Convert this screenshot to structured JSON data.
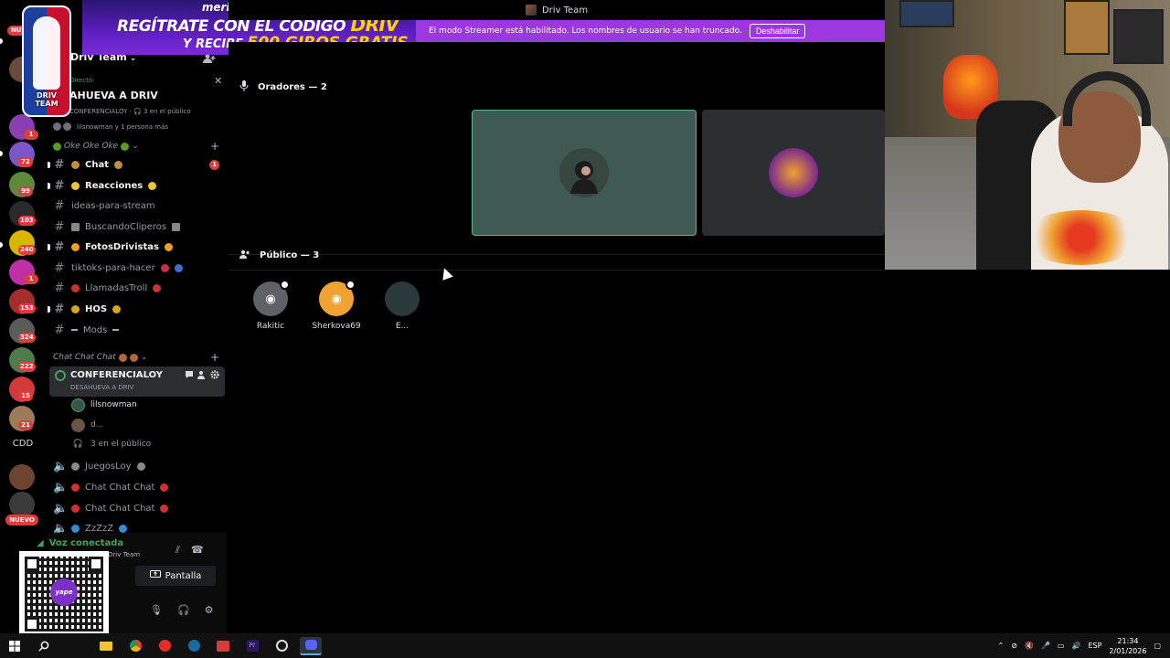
{
  "window": {
    "title": "Driv Team"
  },
  "ad": {
    "brand": "meridiancasino",
    "line1_prefix": "REGÍTRATE CON EL CÓDIGO",
    "code": "DRIV",
    "line2_prefix": "Y RECIBE",
    "line2_highlight": "500 GIROS GRATIS"
  },
  "streamer_bar": {
    "message": "El modo Streamer está habilitado. Los nombres de usuario se han truncado.",
    "button": "Deshabilitar"
  },
  "logo": {
    "text_line1": "DRIV",
    "text_line2": "TEAM"
  },
  "rail": {
    "badges": [
      "72",
      "99",
      "103",
      "240",
      "1",
      "153",
      "324",
      "222",
      "15",
      "21"
    ],
    "new_label": "NUEVO",
    "top_label": "NUE",
    "text_server": "CDD",
    "mention_badge": "1"
  },
  "server": {
    "name": "Driv Team"
  },
  "event": {
    "tag": "Directo",
    "title": "AHUEVA A DRIV",
    "host": "CONFERENCIALOY",
    "audience": "3 en el público",
    "users": "lilsnowman y 1 persona más"
  },
  "categories": [
    {
      "label": "Oke Oke Oke"
    },
    {
      "label": "Chat Chat Chat"
    }
  ],
  "channels": [
    {
      "name": "Chat",
      "bold": true,
      "badge": "1"
    },
    {
      "name": "Reacciones",
      "bold": true
    },
    {
      "name": "ideas-para-stream",
      "bold": false
    },
    {
      "name": "BuscandoCliperos",
      "bold": false
    },
    {
      "name": "FotosDrivistas",
      "bold": true
    },
    {
      "name": "tiktoks-para-hacer",
      "bold": false
    },
    {
      "name": "LlamadasTroll",
      "bold": false
    },
    {
      "name": "HOS",
      "bold": true
    },
    {
      "name": "Mods",
      "bold": false
    }
  ],
  "stage_channel": {
    "name": "CONFERENCIALOY",
    "subtitle": "DESAHUEVA A DRIV",
    "users": [
      "lilsnowman",
      "d..."
    ],
    "audience": "3 en el público"
  },
  "voice_channels": [
    {
      "name": "JuegosLoy"
    },
    {
      "name": "Chat Chat Chat"
    },
    {
      "name": "Chat Chat Chat"
    },
    {
      "name": "ZzZzZ"
    }
  ],
  "voice_panel": {
    "status": "Voz conectada",
    "server": "Driv Team",
    "screen_button": "Pantalla"
  },
  "qr": {
    "brand": "yape"
  },
  "stage": {
    "speakers_heading": "Oradores — 2",
    "audience_heading": "Público — 3",
    "audience": [
      {
        "name": "Rakitic",
        "color": "#5f6167"
      },
      {
        "name": "Sherkova69",
        "color": "#f0a232"
      },
      {
        "name": "E...",
        "color": "#2a3a3a"
      }
    ]
  },
  "taskbar": {
    "language": "ESP",
    "time": "21:34",
    "date": "2/01/2026"
  },
  "colors": {
    "streamer": "#9b38e0",
    "online": "#3ba55d",
    "badge": "#e13b3b",
    "speaker_border": "#57b888"
  }
}
